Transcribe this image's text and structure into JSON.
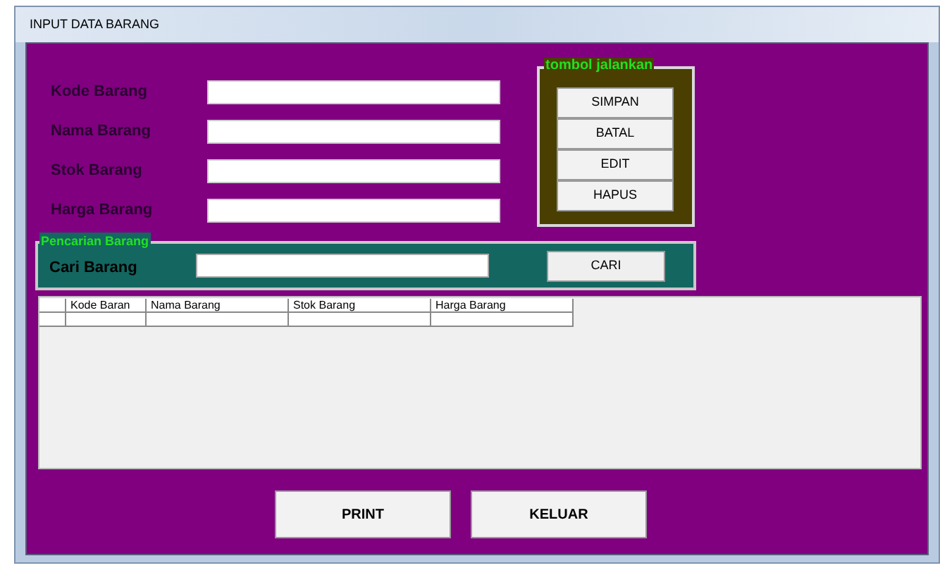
{
  "window": {
    "title": "INPUT DATA BARANG"
  },
  "form": {
    "fields": [
      {
        "label": "Kode Barang"
      },
      {
        "label": "Nama Barang"
      },
      {
        "label": "Stok Barang"
      },
      {
        "label": "Harga Barang"
      }
    ]
  },
  "actions": {
    "title": "tombol jalankan",
    "buttons": [
      "SIMPAN",
      "BATAL",
      "EDIT",
      "HAPUS"
    ]
  },
  "search": {
    "title": "Pencarian Barang",
    "label": "Cari Barang",
    "button": "CARI"
  },
  "table": {
    "columns": [
      "Kode Baran",
      "Nama Barang",
      "Stok Barang",
      "Harga Barang"
    ]
  },
  "buttons": [
    "PRINT",
    "KELUAR"
  ]
}
